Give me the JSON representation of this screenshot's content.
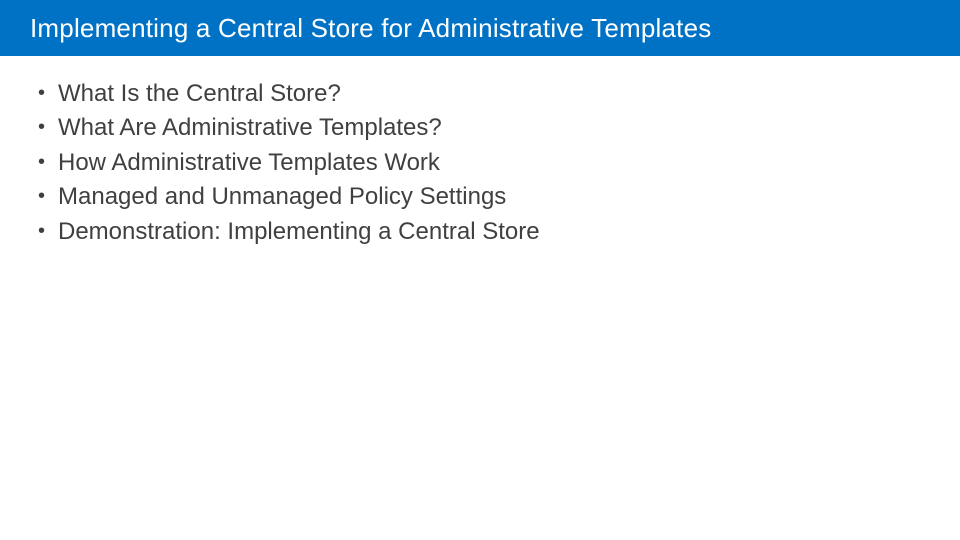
{
  "header": {
    "title": "Implementing a Central Store for Administrative Templates"
  },
  "bullets": [
    {
      "text": "What Is the Central Store?"
    },
    {
      "text": "What Are Administrative Templates?"
    },
    {
      "text": "How Administrative Templates Work"
    },
    {
      "text": "Managed and Unmanaged Policy Settings"
    },
    {
      "text": "Demonstration: Implementing a Central Store"
    }
  ]
}
